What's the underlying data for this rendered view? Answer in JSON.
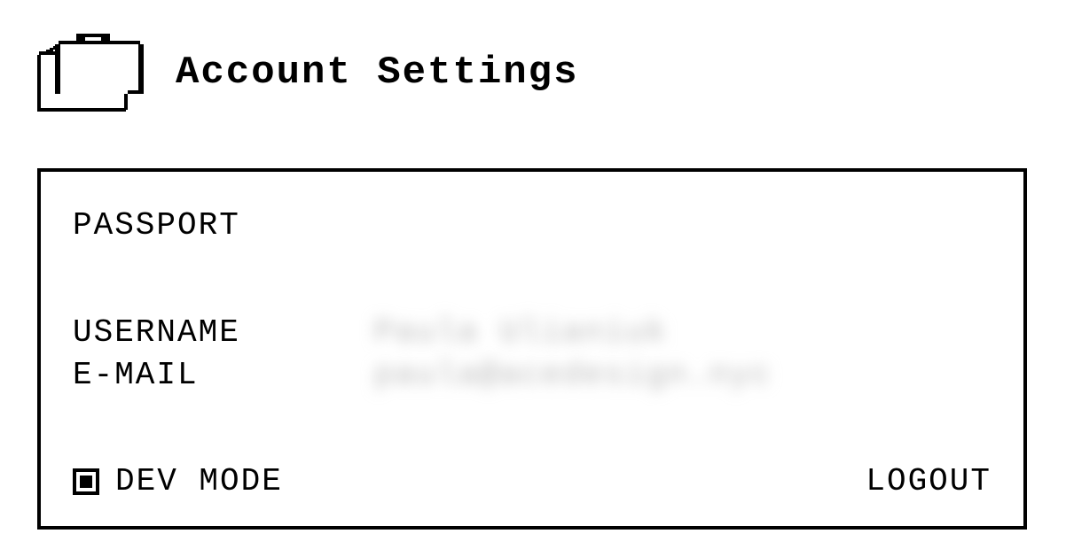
{
  "header": {
    "title": "Account Settings"
  },
  "panel": {
    "section_label": "PASSPORT",
    "username_label": "USERNAME",
    "email_label": "E-MAIL",
    "username_value": "Paula Ulianiuk",
    "email_value": "paula@acedesign.nyc",
    "dev_mode_label": "DEV MODE",
    "dev_mode_checked": true,
    "logout_label": "LOGOUT"
  }
}
